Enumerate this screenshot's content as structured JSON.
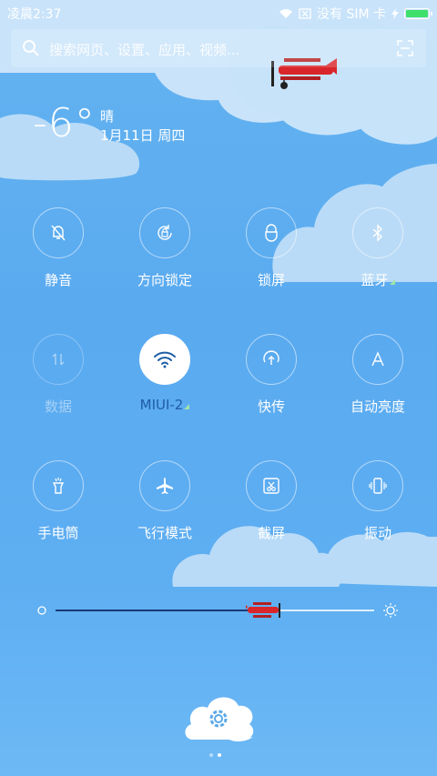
{
  "status_bar": {
    "time": "凌晨2:37",
    "no_sim": "没有 SIM 卡"
  },
  "search": {
    "placeholder": "搜索网页、设置、应用、视频..."
  },
  "weather": {
    "temperature": "-6°",
    "condition": "晴",
    "date": "1月11日 周四"
  },
  "toggles": [
    {
      "label": "静音",
      "icon": "bell-off-icon",
      "state": "off"
    },
    {
      "label": "方向锁定",
      "icon": "rotation-lock-icon",
      "state": "off"
    },
    {
      "label": "锁屏",
      "icon": "lock-icon",
      "state": "off"
    },
    {
      "label": "蓝牙",
      "icon": "bluetooth-icon",
      "state": "off"
    },
    {
      "label": "数据",
      "icon": "data-arrows-icon",
      "state": "disabled"
    },
    {
      "label": "MIUI-2",
      "icon": "wifi-icon",
      "state": "on"
    },
    {
      "label": "快传",
      "icon": "share-upload-icon",
      "state": "off"
    },
    {
      "label": "自动亮度",
      "icon": "auto-brightness-icon",
      "state": "off"
    },
    {
      "label": "手电筒",
      "icon": "flashlight-icon",
      "state": "off"
    },
    {
      "label": "飞行模式",
      "icon": "airplane-icon",
      "state": "off"
    },
    {
      "label": "截屏",
      "icon": "screenshot-icon",
      "state": "off"
    },
    {
      "label": "振动",
      "icon": "vibrate-icon",
      "state": "off"
    }
  ],
  "brightness": {
    "level": 0.7
  },
  "page_indicator": {
    "count": 2,
    "current": 2
  },
  "colors": {
    "accent_dark": "#1e5da6",
    "battery": "#3ee06b",
    "plane_red": "#d9262b"
  }
}
